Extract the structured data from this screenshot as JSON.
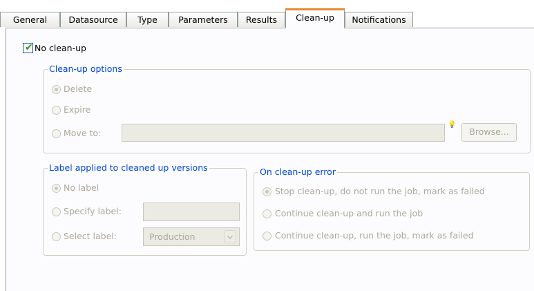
{
  "tabs": [
    {
      "label": "General",
      "active": false
    },
    {
      "label": "Datasource",
      "active": false
    },
    {
      "label": "Type",
      "active": false
    },
    {
      "label": "Parameters",
      "active": false
    },
    {
      "label": "Results",
      "active": false
    },
    {
      "label": "Clean-up",
      "active": true
    },
    {
      "label": "Notifications",
      "active": false
    }
  ],
  "no_cleanup": {
    "label": "No clean-up",
    "checked": true
  },
  "cleanup_options": {
    "legend": "Clean-up options",
    "delete_label": "Delete",
    "expire_label": "Expire",
    "move_to_label": "Move to:",
    "move_to_value": "",
    "browse_label": "Browse...",
    "selected": "Delete"
  },
  "label_group": {
    "legend": "Label applied to cleaned up versions",
    "no_label": "No label",
    "specify_label": "Specify label:",
    "specify_value": "",
    "select_label": "Select label:",
    "select_value": "Production",
    "selected": "No label"
  },
  "error_group": {
    "legend": "On clean-up error",
    "stop_label": "Stop clean-up, do not run the job, mark as failed",
    "continue_run_label": "Continue clean-up and run the job",
    "continue_fail_label": "Continue clean-up, run the job, mark as failed",
    "selected": "Stop clean-up, do not run the job, mark as failed"
  },
  "colors": {
    "accent_tab": "#e68b2c",
    "legend_text": "#0046d5",
    "disabled_text": "#aca899"
  }
}
